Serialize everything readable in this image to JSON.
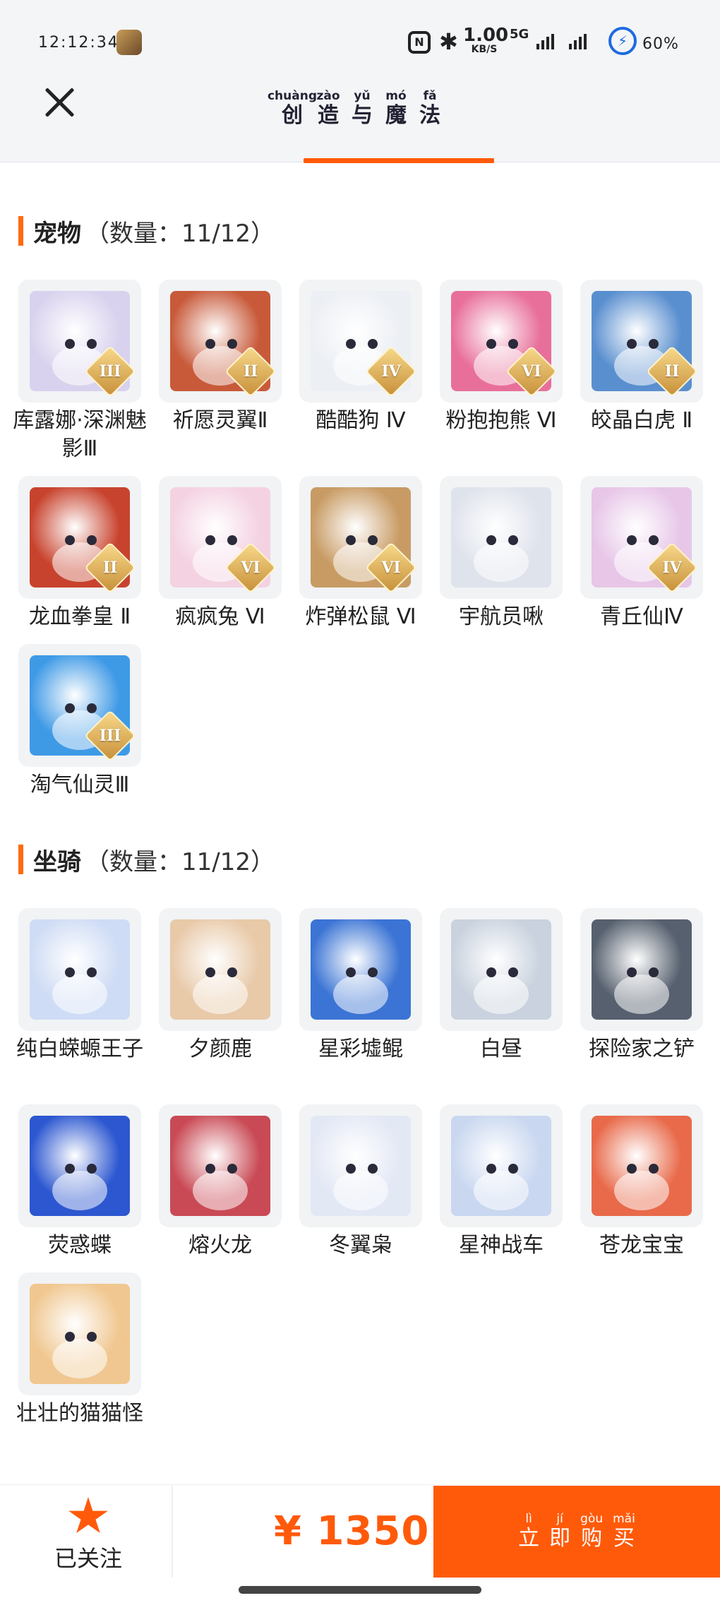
{
  "status_bar": {
    "time": "12:12:34",
    "nfc": "N",
    "speed_value": "1.00",
    "speed_unit": "KB/S",
    "network": "5G",
    "battery_percent": "60%",
    "colors": {
      "battery_ring": "#1e6be0"
    }
  },
  "header": {
    "title_chars": [
      {
        "pinyin": "chuàng",
        "hanzi": "创"
      },
      {
        "pinyin": "zào",
        "hanzi": "造"
      },
      {
        "pinyin": "yǔ",
        "hanzi": "与"
      },
      {
        "pinyin": "mó",
        "hanzi": "魔"
      },
      {
        "pinyin": "fǎ",
        "hanzi": "法"
      }
    ],
    "close_icon": "close-icon",
    "accent": "#ff5a0a"
  },
  "pets": {
    "name": "宠物",
    "count": "（数量：11/12）",
    "items": [
      {
        "label": "库露娜·深渊魅影Ⅲ",
        "tier": "III",
        "color": "#d9d2ee"
      },
      {
        "label": "祈愿灵翼Ⅱ",
        "tier": "II",
        "color": "#c85a3a"
      },
      {
        "label": "酷酷狗 Ⅳ",
        "tier": "IV",
        "color": "#eceff4"
      },
      {
        "label": "粉抱抱熊 Ⅵ",
        "tier": "VI",
        "color": "#e86f9a"
      },
      {
        "label": "皎晶白虎 Ⅱ",
        "tier": "II",
        "color": "#5a8fcf"
      },
      {
        "label": "龙血拳皇 Ⅱ",
        "tier": "II",
        "color": "#c8432e"
      },
      {
        "label": "疯疯兔 Ⅵ",
        "tier": "VI",
        "color": "#f4d2e2"
      },
      {
        "label": "炸弹松鼠 Ⅵ",
        "tier": "VI",
        "color": "#c89b64"
      },
      {
        "label": "宇航员啾",
        "tier": "",
        "color": "#dfe3ec"
      },
      {
        "label": "青丘仙Ⅳ",
        "tier": "IV",
        "color": "#e7c6e8"
      },
      {
        "label": "淘气仙灵Ⅲ",
        "tier": "III",
        "color": "#3f9ae6"
      }
    ]
  },
  "mounts": {
    "name": "坐骑",
    "count": "（数量：11/12）",
    "items": [
      {
        "label": "纯白蝾螈王子",
        "color": "#cfdcf5"
      },
      {
        "label": "夕颜鹿",
        "color": "#e8c9a8"
      },
      {
        "label": "星彩墟鲲",
        "color": "#3b74d4"
      },
      {
        "label": "白昼",
        "color": "#c9d2de"
      },
      {
        "label": "探险家之铲",
        "color": "#56606e"
      },
      {
        "label": "荧惑蝶",
        "color": "#2c57d0"
      },
      {
        "label": "熔火龙",
        "color": "#c94a55"
      },
      {
        "label": "冬翼枭",
        "color": "#e3e8f5"
      },
      {
        "label": "星神战车",
        "color": "#c9d7f0"
      },
      {
        "label": "苍龙宝宝",
        "color": "#e86a4a"
      },
      {
        "label": "壮壮的猫猫怪",
        "color": "#f0c790"
      }
    ]
  },
  "bottom": {
    "follow_label": "已关注",
    "price": "¥ 1350",
    "buy_chars": [
      {
        "pinyin": "lì",
        "hanzi": "立"
      },
      {
        "pinyin": "jí",
        "hanzi": "即"
      },
      {
        "pinyin": "gòu",
        "hanzi": "购"
      },
      {
        "pinyin": "mǎi",
        "hanzi": "买"
      }
    ]
  }
}
